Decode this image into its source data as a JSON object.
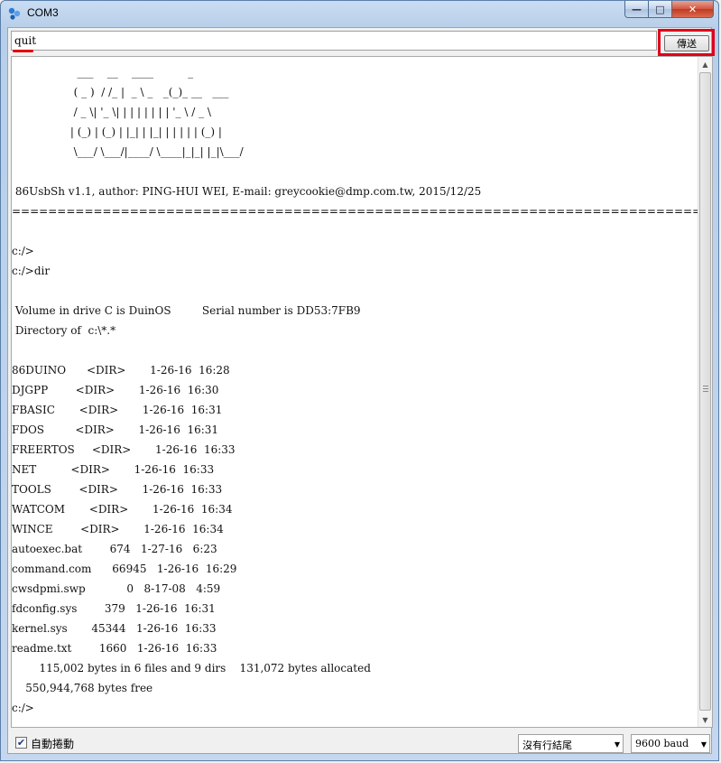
{
  "window": {
    "title": "COM3",
    "minimize_glyph": "—",
    "maximize_glyph": "□",
    "close_glyph": "✕"
  },
  "toolbar": {
    "input_value": "quit",
    "send_label": "傳送"
  },
  "output": {
    "lines": [
      "                   ___    __    ____          _",
      "                  ( _ )  / /_ |  _ \\ _   _(_)_ __   ___",
      "                  / _ \\| '_ \\| | | | | | | | '_ \\ / _ \\",
      "                 | (_) | (_) | |_| | |_| | | | | | (_) |",
      "                  \\___/ \\___/|____/ \\____|_|_| |_|\\___/",
      "",
      " 86UsbSh v1.1, author: PING-HUI WEI, E-mail: greycookie@dmp.com.tw, 2015/12/25",
      "================================================================================",
      "",
      "c:/>",
      "c:/>dir",
      "",
      " Volume in drive C is DuinOS         Serial number is DD53:7FB9",
      " Directory of  c:\\*.*",
      "",
      "86DUINO      <DIR>       1-26-16  16:28",
      "DJGPP        <DIR>       1-26-16  16:30",
      "FBASIC       <DIR>       1-26-16  16:31",
      "FDOS         <DIR>       1-26-16  16:31",
      "FREERTOS     <DIR>       1-26-16  16:33",
      "NET          <DIR>       1-26-16  16:33",
      "TOOLS        <DIR>       1-26-16  16:33",
      "WATCOM       <DIR>       1-26-16  16:34",
      "WINCE        <DIR>       1-26-16  16:34",
      "autoexec.bat        674   1-27-16   6:23",
      "command.com      66945   1-26-16  16:29",
      "cwsdpmi.swp            0   8-17-08   4:59",
      "fdconfig.sys        379   1-26-16  16:31",
      "kernel.sys       45344   1-26-16  16:33",
      "readme.txt        1660   1-26-16  16:33",
      "        115,002 bytes in 6 files and 9 dirs    131,072 bytes allocated",
      "    550,944,768 bytes free",
      "c:/>"
    ]
  },
  "status": {
    "autoscroll_label": "自動捲動",
    "autoscroll_checked": true,
    "line_ending": "沒有行結尾",
    "baud": "9600 baud"
  }
}
